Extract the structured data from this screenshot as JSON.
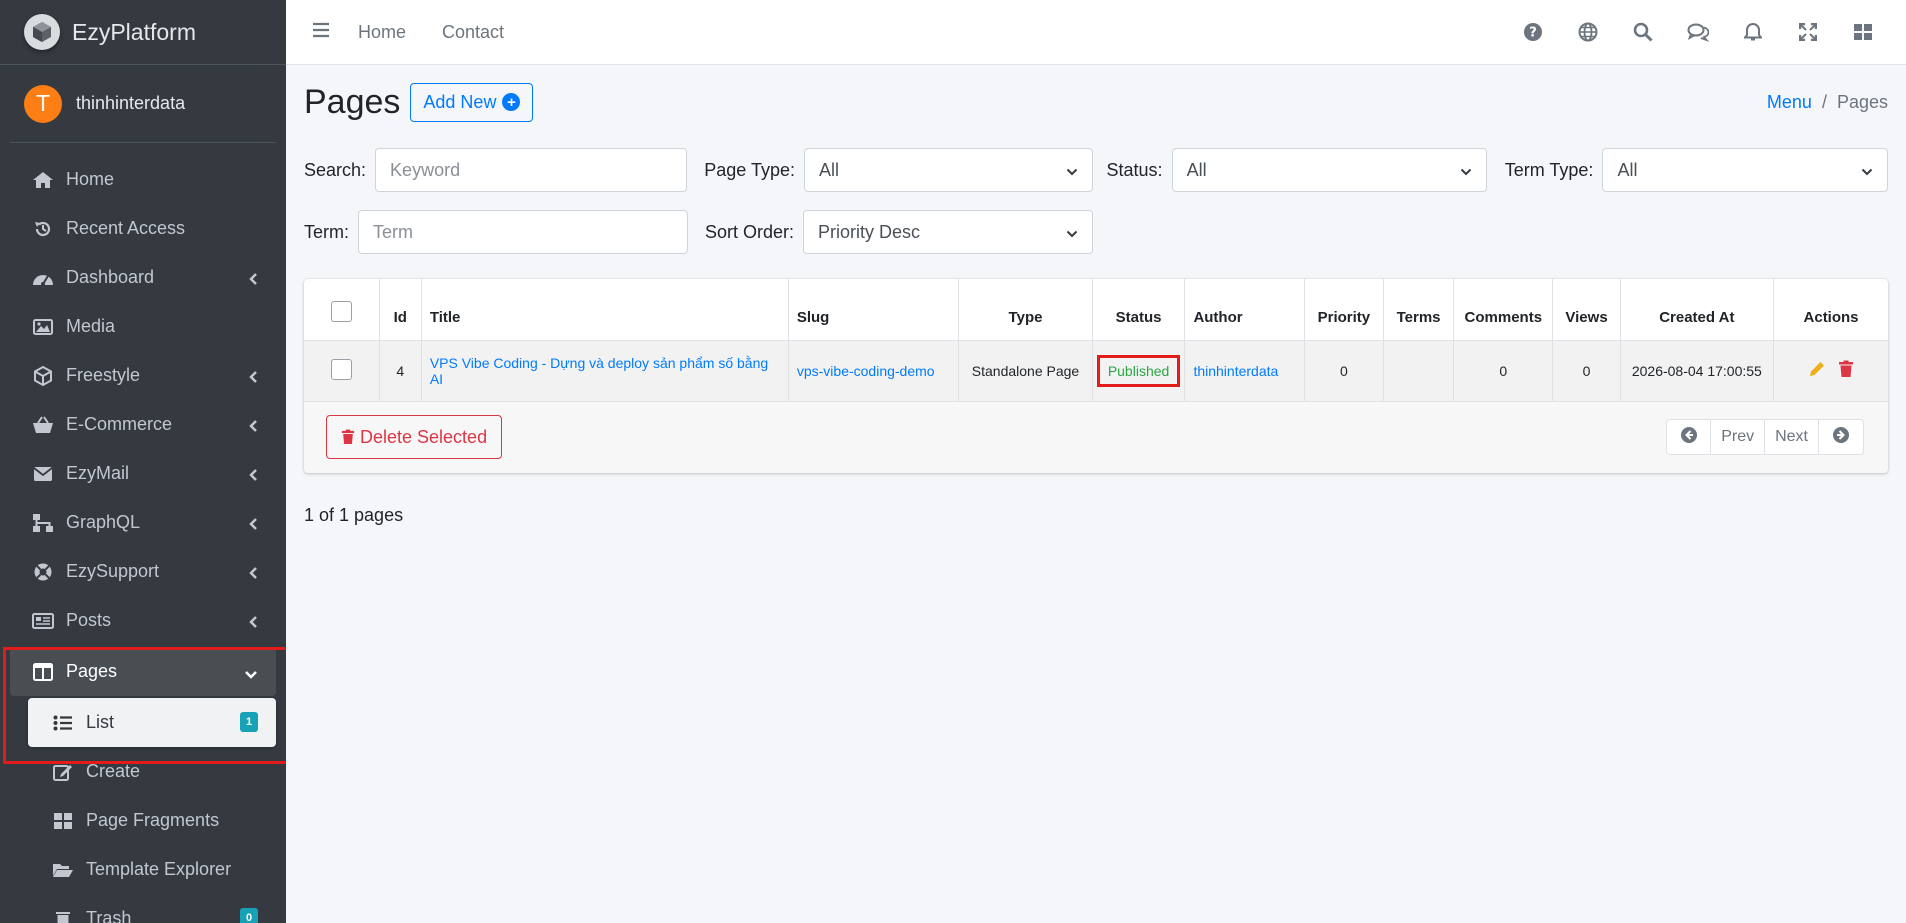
{
  "brand": {
    "name": "EzyPlatform"
  },
  "user": {
    "initial": "T",
    "name": "thinhinterdata"
  },
  "sidebar": {
    "items": [
      {
        "label": "Home"
      },
      {
        "label": "Recent Access"
      },
      {
        "label": "Dashboard"
      },
      {
        "label": "Media"
      },
      {
        "label": "Freestyle"
      },
      {
        "label": "E-Commerce"
      },
      {
        "label": "EzyMail"
      },
      {
        "label": "GraphQL"
      },
      {
        "label": "EzySupport"
      },
      {
        "label": "Posts"
      },
      {
        "label": "Pages"
      }
    ],
    "pages_sub": [
      {
        "label": "List",
        "badge": "1"
      },
      {
        "label": "Create"
      },
      {
        "label": "Page Fragments"
      },
      {
        "label": "Template Explorer"
      },
      {
        "label": "Trash",
        "badge": "0"
      }
    ]
  },
  "topbar": {
    "links": [
      "Home",
      "Contact"
    ]
  },
  "header": {
    "title": "Pages",
    "add_new": "Add New",
    "breadcrumb": {
      "link": "Menu",
      "current": "Pages"
    }
  },
  "filters": {
    "search_label": "Search:",
    "search_placeholder": "Keyword",
    "page_type_label": "Page Type:",
    "page_type_value": "All",
    "status_label": "Status:",
    "status_value": "All",
    "term_type_label": "Term Type:",
    "term_type_value": "All",
    "term_label": "Term:",
    "term_placeholder": "Term",
    "sort_label": "Sort Order:",
    "sort_value": "Priority Desc"
  },
  "table": {
    "headers": [
      "Id",
      "Title",
      "Slug",
      "Type",
      "Status",
      "Author",
      "Priority",
      "Terms",
      "Comments",
      "Views",
      "Created At",
      "Actions"
    ],
    "rows": [
      {
        "id": "4",
        "title": "VPS Vibe Coding - Dựng và deploy sản phẩm số bằng AI",
        "slug": "vps-vibe-coding-demo",
        "type": "Standalone Page",
        "status": "Published",
        "author": "thinhinterdata",
        "priority": "0",
        "terms": "",
        "comments": "0",
        "views": "0",
        "created_at": "2026-08-04 17:00:55"
      }
    ]
  },
  "footer": {
    "delete_selected": "Delete Selected",
    "prev": "Prev",
    "next": "Next",
    "pages_info": "1 of 1 pages"
  },
  "colors": {
    "primary": "#007bff",
    "danger": "#dc3545",
    "success": "#28a745",
    "sidebar": "#343a40",
    "highlight": "#e21b1b"
  }
}
